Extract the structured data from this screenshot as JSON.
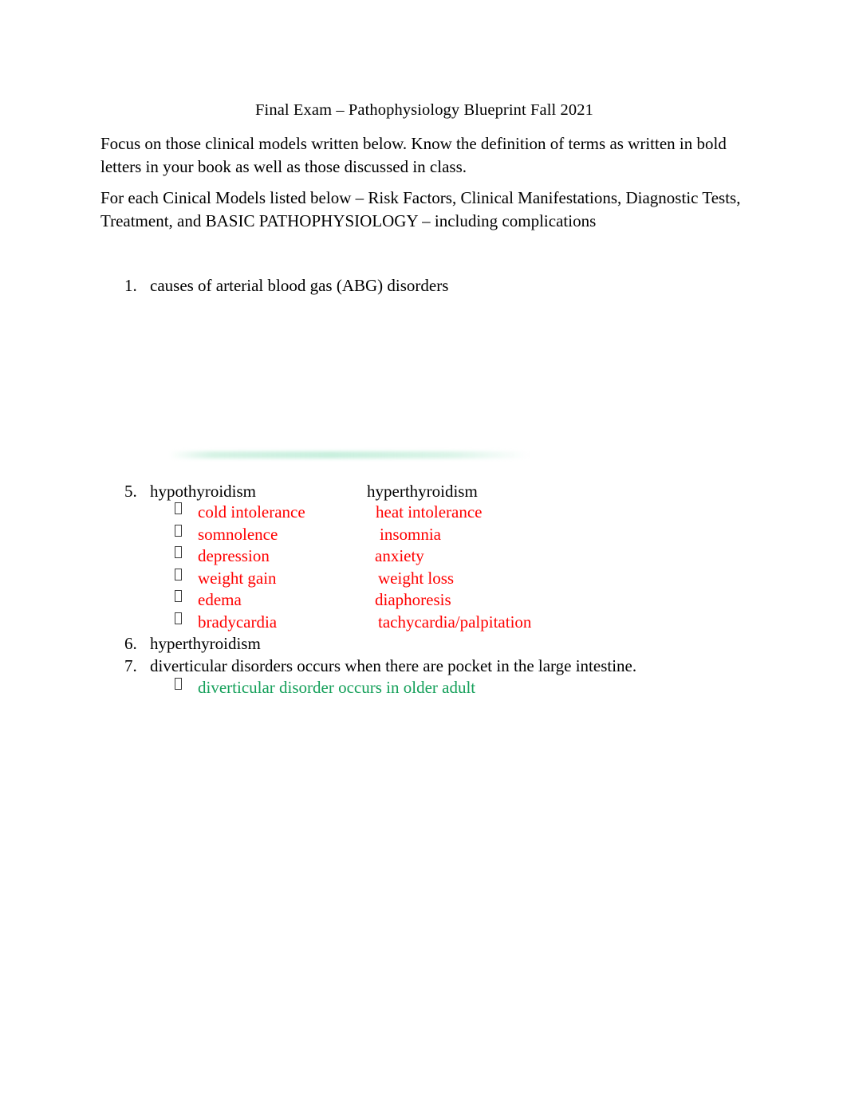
{
  "document": {
    "title": "Final Exam – Pathophysiology Blueprint Fall 2021",
    "paragraphs": [
      "Focus on those clinical models written below. Know the definition of terms as written in bold letters in your book as well as those discussed in class.",
      "For each Cinical Models listed below – Risk Factors, Clinical Manifestations, Diagnostic Tests, Treatment, and BASIC PATHOPHYSIOLOGY – including complications"
    ],
    "list": {
      "item_1": {
        "marker": "1.",
        "text": "causes of arterial blood gas (ABG) disorders"
      },
      "item_5": {
        "marker": "5.",
        "left_heading": "hypothyroidism",
        "right_heading": "hyperthyroidism",
        "bullet_glyph": "tofu-box",
        "rows": [
          {
            "left": "cold intolerance",
            "right": "heat intolerance"
          },
          {
            "left": "somnolence",
            "right": "insomnia"
          },
          {
            "left": "depression",
            "right": "anxiety"
          },
          {
            "left": "weight gain",
            "right": "weight loss"
          },
          {
            "left": "edema",
            "right": "diaphoresis"
          },
          {
            "left": "bradycardia",
            "right": "tachycardia/palpitation"
          }
        ]
      },
      "item_6": {
        "marker": "6.",
        "text": "hyperthyroidism"
      },
      "item_7": {
        "marker": "7.",
        "text": "diverticular disorders occurs when there are pocket in the large intestine.",
        "sub_bullet": "diverticular disorder occurs in older adult"
      }
    },
    "colors": {
      "text": "#000000",
      "red": "#FF0000",
      "green": "#15A05A",
      "page_background": "#FFFFFF"
    }
  }
}
